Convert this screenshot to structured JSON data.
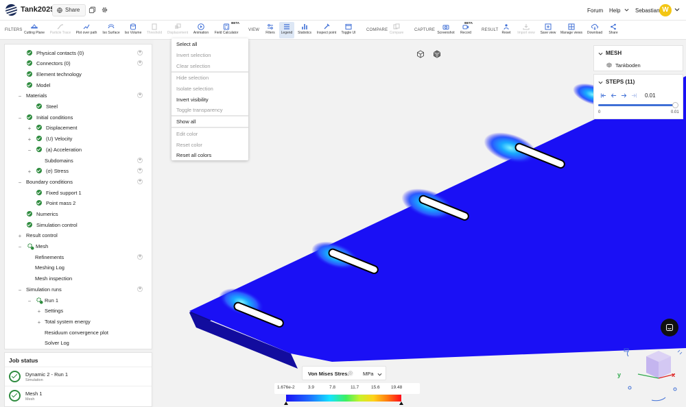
{
  "app": {
    "title": "Tank2025",
    "share_label": "Share",
    "forum_label": "Forum",
    "help_label": "Help",
    "user_name": "Sebastian",
    "avatar_initial": "W"
  },
  "toolbar": {
    "filters_label": "FILTERS",
    "view_label": "VIEW",
    "compare_label": "COMPARE",
    "capture_label": "CAPTURE",
    "result_label": "RESULT",
    "beta_label": "BETA",
    "tools": {
      "cutting_plane": "Cutting Plane",
      "particle_trace": "Particle Trace",
      "plot_over_path": "Plot over path",
      "iso_surface": "Iso Surface",
      "iso_volume": "Iso Volume",
      "threshold": "Threshold",
      "displacement": "Displacement",
      "animation": "Animation",
      "field_calculator": "Field Calculator",
      "filters": "Filters",
      "legend": "Legend",
      "statistics": "Statistics",
      "inspect_point": "Inspect point",
      "toggle_ui": "Toggle UI",
      "compare": "Compare",
      "screenshot": "Screenshot",
      "record": "Record",
      "reset": "Reset",
      "import_view": "Import view",
      "save_view": "Save view",
      "manage_views": "Manage views",
      "download": "Download",
      "share": "Share"
    }
  },
  "tree": {
    "physical_contacts": "Physical contacts (0)",
    "connectors": "Connectors (0)",
    "element_technology": "Element technology",
    "model": "Model",
    "materials": "Materials",
    "steel": "Steel",
    "initial_conditions": "Initial conditions",
    "displacement": "Displacement",
    "velocity": "(U) Velocity",
    "acceleration": "(a) Acceleration",
    "subdomains": "Subdomains",
    "stress": "(σ) Stress",
    "boundary_conditions": "Boundary conditions",
    "fixed_support": "Fixed support 1",
    "point_mass": "Point mass 2",
    "numerics": "Numerics",
    "simulation_control": "Simulation control",
    "result_control": "Result control",
    "mesh": "Mesh",
    "refinements": "Refinements",
    "meshing_log": "Meshing Log",
    "mesh_inspection": "Mesh inspection",
    "simulation_runs": "Simulation runs",
    "run1": "Run 1",
    "settings": "Settings",
    "total_energy": "Total system energy",
    "residuum_plot": "Residuum convergence plot",
    "solver_log": "Solver Log"
  },
  "job_status": {
    "title": "Job status",
    "jobs": [
      {
        "name": "Dynamic 2 - Run 1",
        "type": "Simulation"
      },
      {
        "name": "Mesh 1",
        "type": "Mesh"
      }
    ]
  },
  "context_menu": {
    "select_all": "Select all",
    "invert_selection": "Invert selection",
    "clear_selection": "Clear selection",
    "hide_selection": "Hide selection",
    "isolate_selection": "Isolate selection",
    "invert_visibility": "Invert visibility",
    "toggle_transparency": "Toggle transparency",
    "show_all": "Show all",
    "edit_color": "Edit color",
    "reset_color": "Reset color",
    "reset_all_colors": "Reset all colors"
  },
  "mesh_panel": {
    "title": "MESH",
    "item": "Tankboden"
  },
  "steps_panel": {
    "title": "STEPS (11)",
    "value": "0.01",
    "min_label": "0",
    "max_label": "0.01",
    "position_fraction": 1.0
  },
  "legend": {
    "title": "Von Mises Stress",
    "info": "ⓘ",
    "unit": "MPa",
    "ticks": [
      "1.676e-2",
      "3.9",
      "7.8",
      "11.7",
      "15.6",
      "19.48"
    ]
  },
  "gizmo": {
    "x": "x",
    "y": "y"
  },
  "colors": {
    "accent": "#3f6fd6",
    "success": "#2e8b3e",
    "plate": "#1a10f5",
    "avatar": "#f3c614"
  }
}
